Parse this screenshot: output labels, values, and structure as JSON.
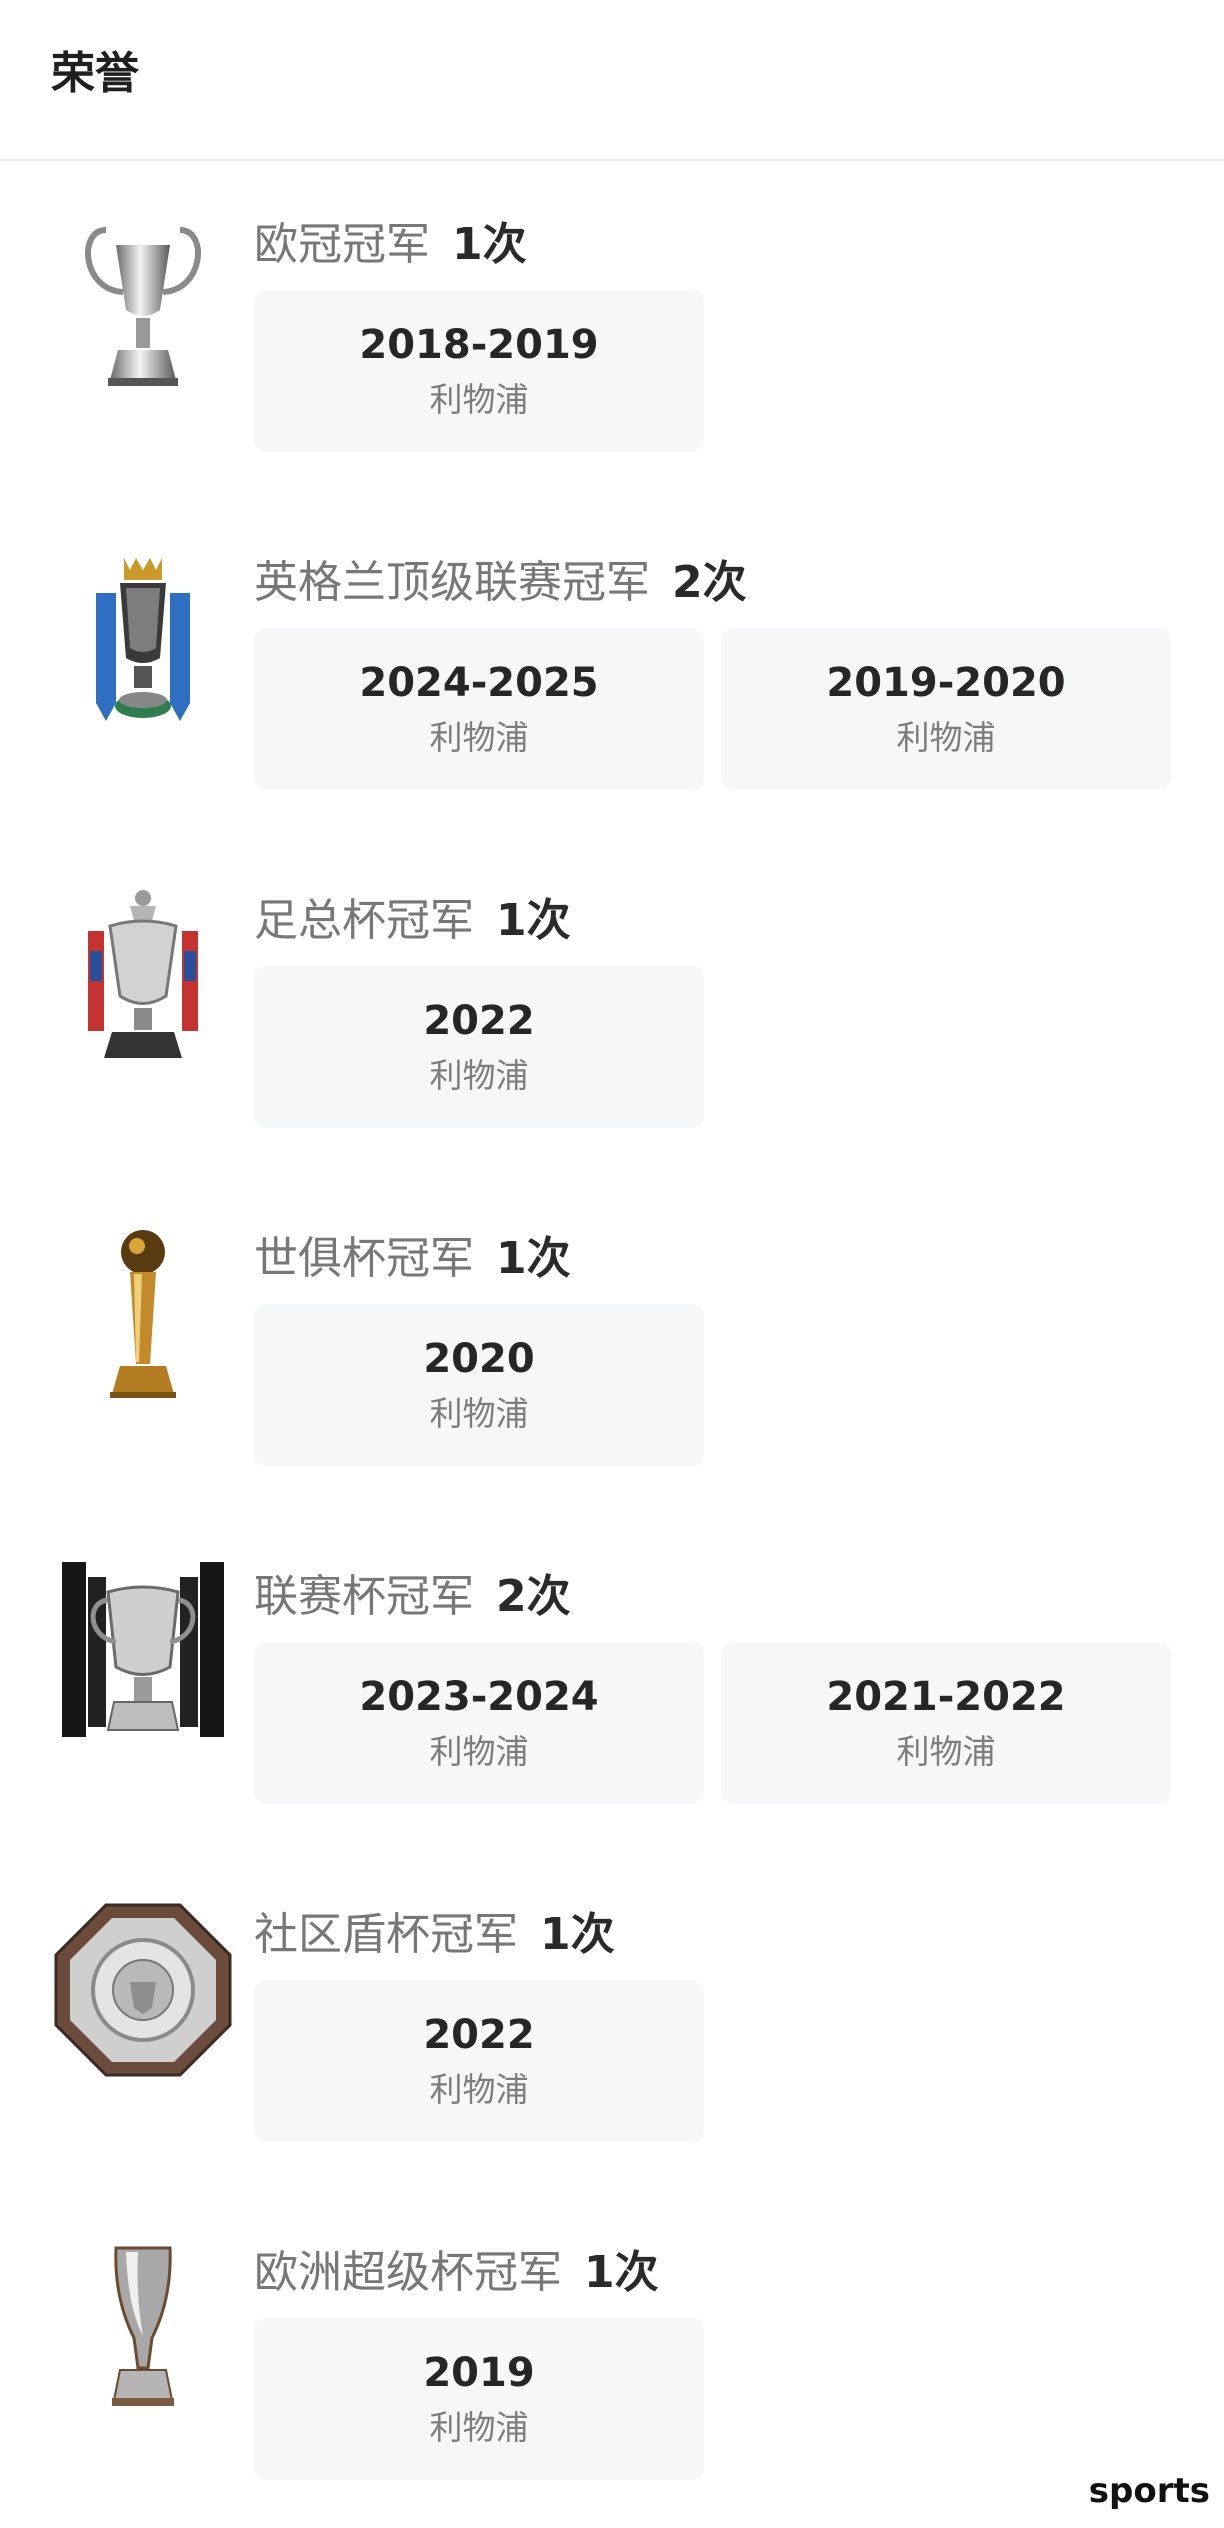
{
  "header": {
    "title": "荣誉"
  },
  "honors": [
    {
      "trophy_icon": "champions-league-trophy-icon",
      "title": "欧冠冠军",
      "count": "1次",
      "items": [
        {
          "season": "2018-2019",
          "team": "利物浦"
        }
      ]
    },
    {
      "trophy_icon": "premier-league-trophy-icon",
      "title": "英格兰顶级联赛冠军",
      "count": "2次",
      "items": [
        {
          "season": "2024-2025",
          "team": "利物浦"
        },
        {
          "season": "2019-2020",
          "team": "利物浦"
        }
      ]
    },
    {
      "trophy_icon": "fa-cup-trophy-icon",
      "title": "足总杯冠军",
      "count": "1次",
      "items": [
        {
          "season": "2022",
          "team": "利物浦"
        }
      ]
    },
    {
      "trophy_icon": "club-world-cup-trophy-icon",
      "title": "世俱杯冠军",
      "count": "1次",
      "items": [
        {
          "season": "2020",
          "team": "利物浦"
        }
      ]
    },
    {
      "trophy_icon": "league-cup-trophy-icon",
      "title": "联赛杯冠军",
      "count": "2次",
      "items": [
        {
          "season": "2023-2024",
          "team": "利物浦"
        },
        {
          "season": "2021-2022",
          "team": "利物浦"
        }
      ]
    },
    {
      "trophy_icon": "community-shield-trophy-icon",
      "title": "社区盾杯冠军",
      "count": "1次",
      "items": [
        {
          "season": "2022",
          "team": "利物浦"
        }
      ]
    },
    {
      "trophy_icon": "uefa-super-cup-trophy-icon",
      "title": "欧洲超级杯冠军",
      "count": "1次",
      "items": [
        {
          "season": "2019",
          "team": "利物浦"
        }
      ]
    }
  ],
  "watermark": "sports"
}
